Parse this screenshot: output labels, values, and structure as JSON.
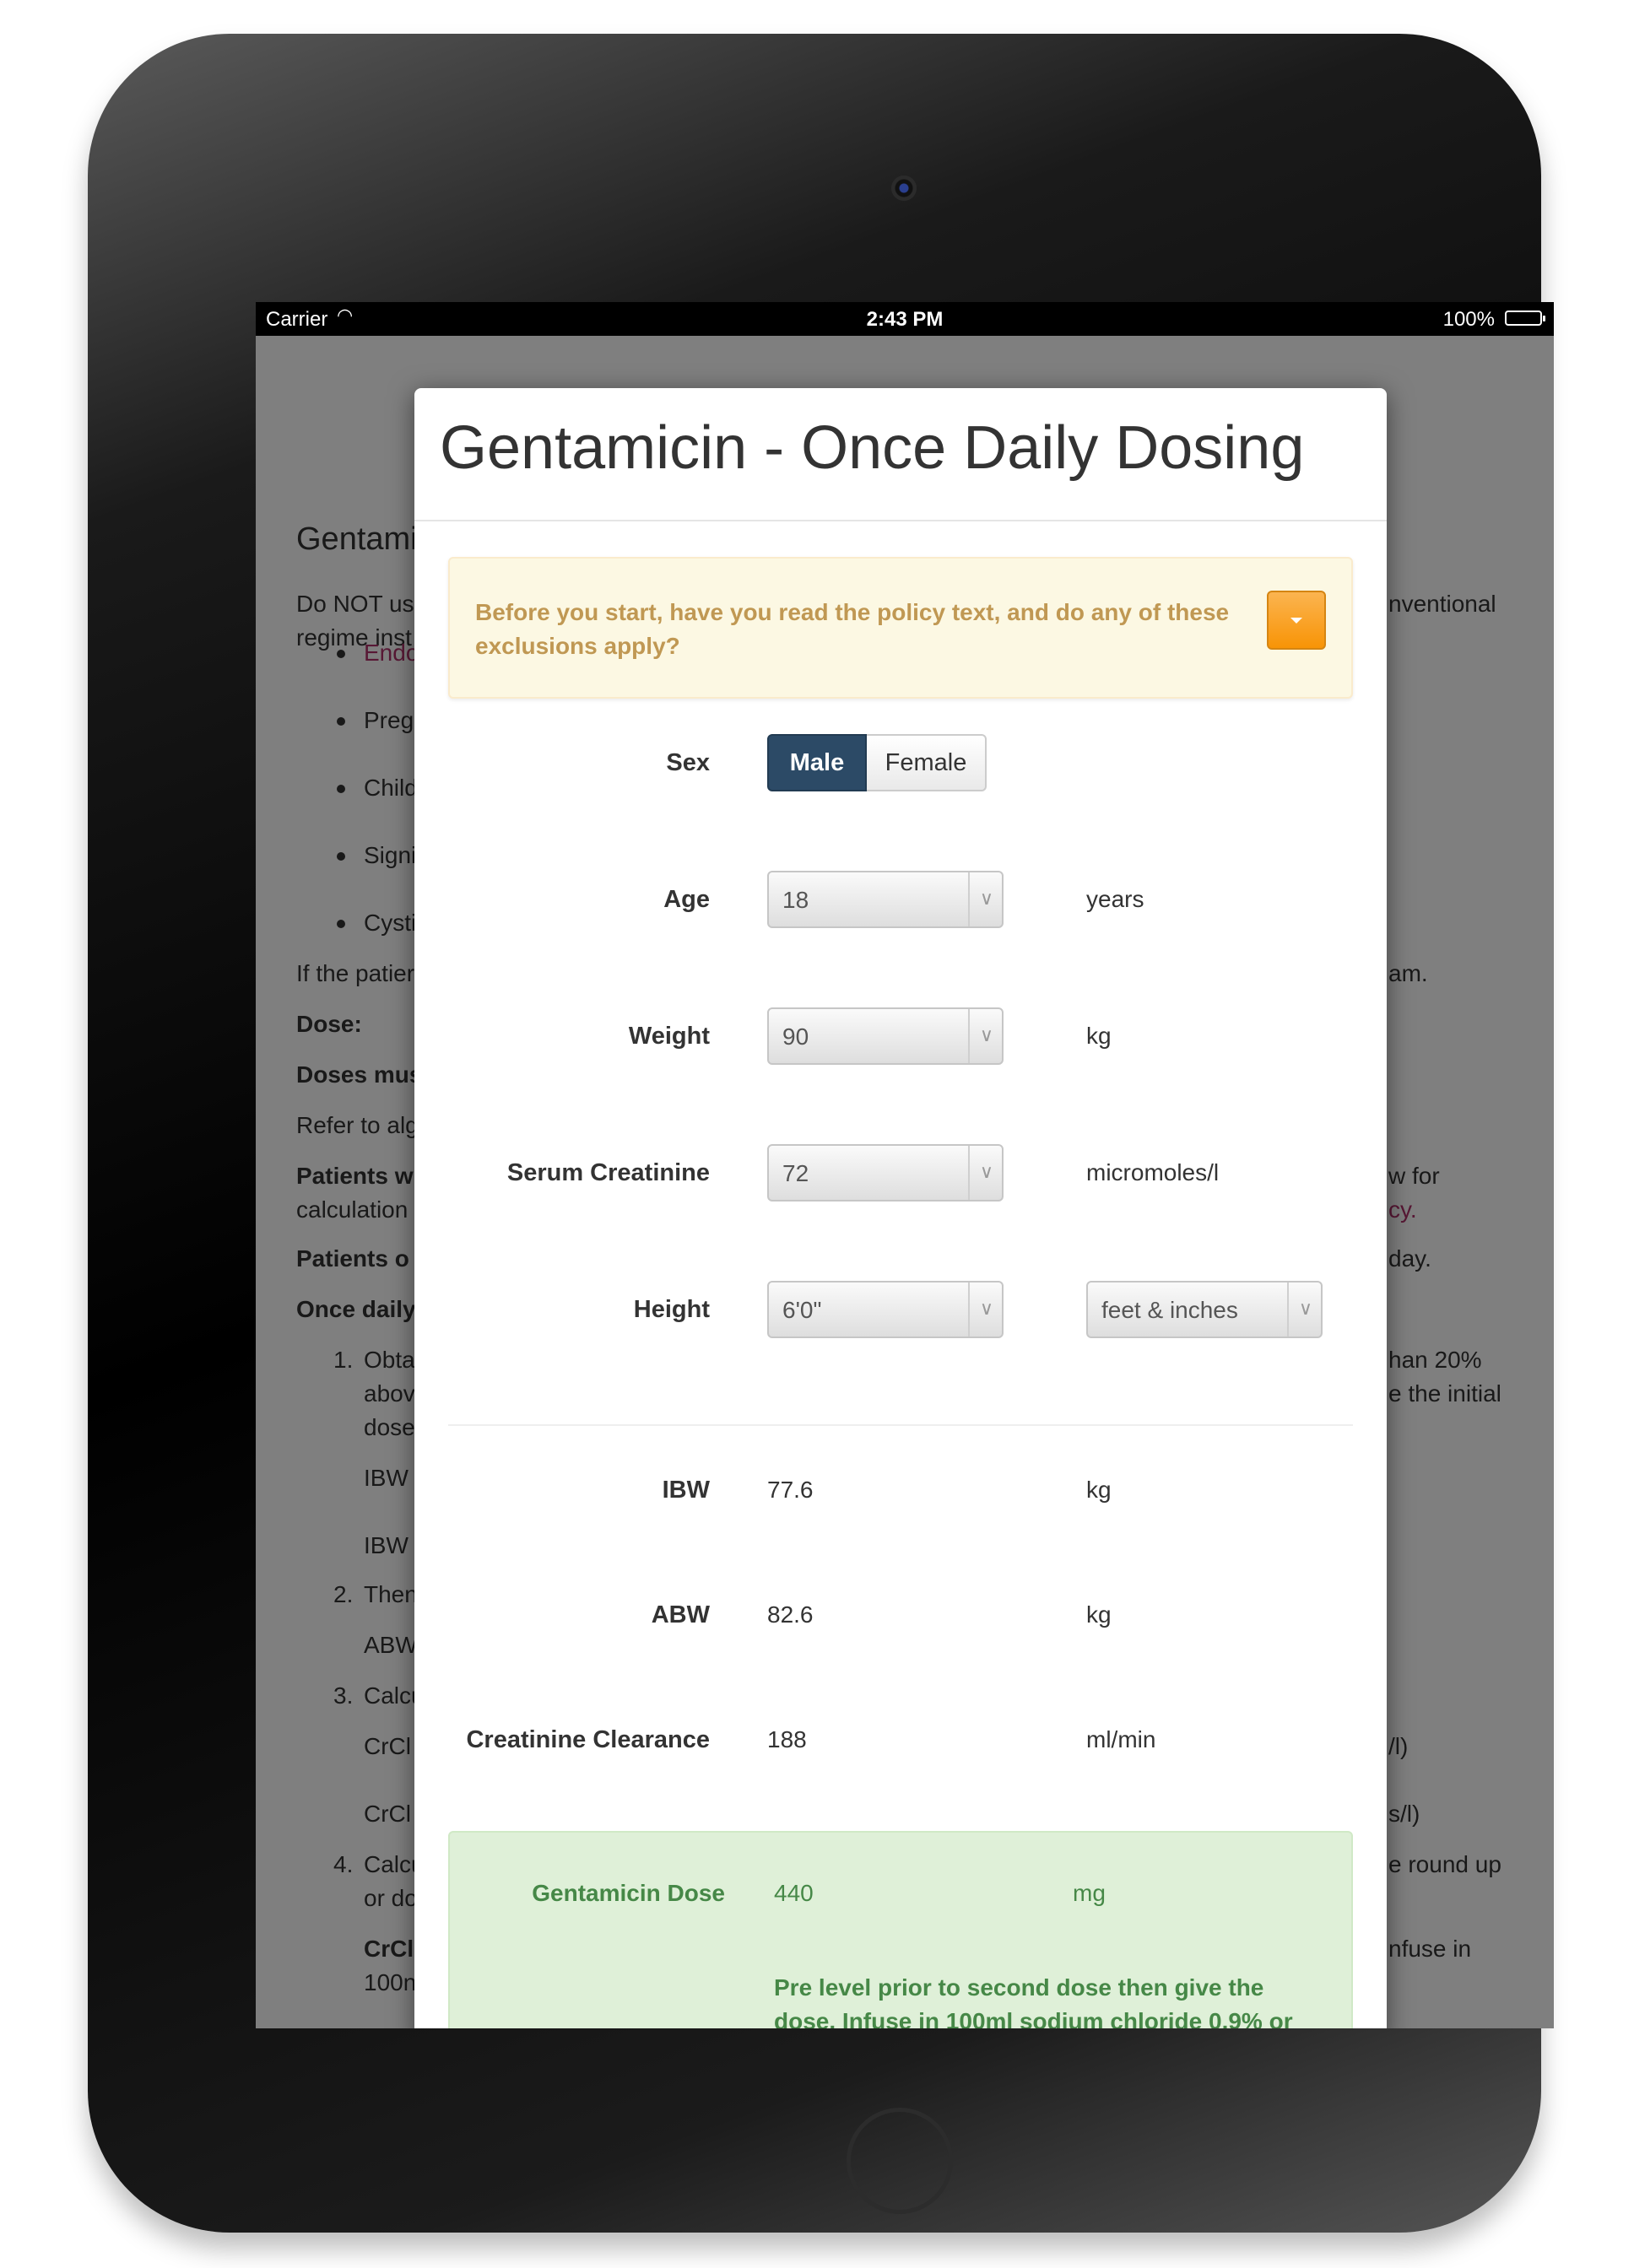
{
  "status_bar": {
    "carrier": "Carrier",
    "time": "2:43 PM",
    "battery": "100%"
  },
  "background_doc": {
    "heading": "Gentami",
    "intro_left_1": "Do NOT us",
    "intro_left_2": "regime inst",
    "intro_right": "nventional",
    "bullets": [
      "Endo",
      "Preg",
      "Child",
      "Signi",
      "Cysti"
    ],
    "if_patient": "If the patier",
    "if_patient_right": "am.",
    "dose": "Dose:",
    "doses_must": "Doses mus",
    "refer": "Refer to alg",
    "patients_w": "Patients w",
    "patients_w_right": "w for",
    "calculation": "calculation",
    "calculation_right": "cy.",
    "patients_o": "Patients o",
    "patients_o_right": "day.",
    "once_daily": "Once daily",
    "step1_a": "Obta",
    "step1_b": "abov",
    "step1_c": "dose",
    "step1_right_a": "han 20%",
    "step1_right_b": "e the initial",
    "ibw1": "IBW",
    "ibw2": "IBW",
    "step2": "Then",
    "abw": "ABW",
    "step3": "Calcu",
    "crcl1": "CrCl",
    "crcl1_right": "/l)",
    "crcl2": "CrCl",
    "crcl2_right": "s/l)",
    "step4_a": "Calcu",
    "step4_b": "or do",
    "step4_right": "e round up",
    "crcl3": "CrCl",
    "crcl3_right": "nfuse in",
    "last": "100n",
    "nums": [
      "1.",
      "2.",
      "3.",
      "4."
    ]
  },
  "modal": {
    "title": "Gentamicin - Once Daily Dosing",
    "warning": "Before you start, have you read the policy text, and do any of these exclusions apply?",
    "sex": {
      "label": "Sex",
      "options": [
        "Male",
        "Female"
      ],
      "selected": "Male"
    },
    "age": {
      "label": "Age",
      "value": "18",
      "unit": "years"
    },
    "weight": {
      "label": "Weight",
      "value": "90",
      "unit": "kg"
    },
    "creatinine": {
      "label": "Serum Creatinine",
      "value": "72",
      "unit": "micromoles/l"
    },
    "height": {
      "label": "Height",
      "value": "6'0\"",
      "unit": "feet & inches"
    },
    "ibw": {
      "label": "IBW",
      "value": "77.6",
      "unit": "kg"
    },
    "abw": {
      "label": "ABW",
      "value": "82.6",
      "unit": "kg"
    },
    "crcl": {
      "label": "Creatinine Clearance",
      "value": "188",
      "unit": "ml/min"
    },
    "dose": {
      "label": "Gentamicin Dose",
      "value": "440",
      "unit": "mg",
      "note": "Pre level prior to second dose then give the dose. Infuse in 100ml sodium chloride 0.9% or"
    }
  },
  "colors": {
    "accent_dark": "#2c4a66",
    "warning_text": "#c09853",
    "success_text": "#468847",
    "warning_button": "#f89406"
  }
}
